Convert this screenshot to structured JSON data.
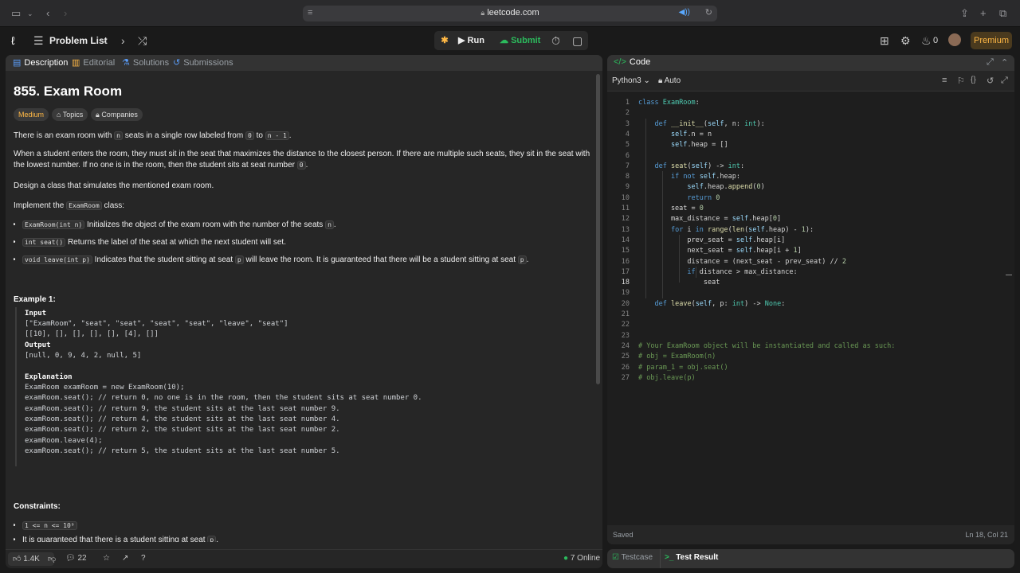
{
  "browser": {
    "url": "leetcode.com"
  },
  "nav": {
    "problem_list_label": "Problem List",
    "run_label": "Run",
    "submit_label": "Submit",
    "coins": "0",
    "premium_label": "Premium"
  },
  "left_tabs": [
    {
      "label": "Description",
      "icon": "document-icon"
    },
    {
      "label": "Editorial",
      "icon": "book-icon"
    },
    {
      "label": "Solutions",
      "icon": "flask-icon"
    },
    {
      "label": "Submissions",
      "icon": "history-icon"
    }
  ],
  "problem": {
    "title": "855. Exam Room",
    "difficulty": "Medium",
    "topics_label": "Topics",
    "companies_label": "Companies",
    "p1_a": "There is an exam room with ",
    "p1_code1": "n",
    "p1_b": " seats in a single row labeled from ",
    "p1_code2": "0",
    "p1_c": " to ",
    "p1_code3": "n - 1",
    "p1_d": ".",
    "p2_line1": "When a student enters the room, they must sit in the seat that maximizes the distance to the closest person. If there are multiple such seats, they sit in the seat with",
    "p2_line2_a": "the lowest number. If no one is in the room, then the student sits at seat number ",
    "p2_code": "0",
    "p2_line2_b": ".",
    "p3": "Design a class that simulates the mentioned exam room.",
    "p4_a": "Implement the ",
    "p4_code": "ExamRoom",
    "p4_b": " class:",
    "b1_code": "ExamRoom(int n)",
    "b1_a": " Initializes the object of the exam room with the number of the seats ",
    "b1_code2": "n",
    "b1_b": ".",
    "b2_code": "int seat()",
    "b2_a": " Returns the label of the seat at which the next student will set.",
    "b3_code": "void leave(int p)",
    "b3_a": " Indicates that the student sitting at seat ",
    "b3_code2": "p",
    "b3_b": " will leave the room. It is guaranteed that there will be a student sitting at seat ",
    "b3_code3": "p",
    "b3_c": ".",
    "example_title": "Example 1:",
    "example_lines": [
      "Input",
      "[\"ExamRoom\", \"seat\", \"seat\", \"seat\", \"seat\", \"leave\", \"seat\"]",
      "[[10], [], [], [], [], [4], []]",
      "Output",
      "[null, 0, 9, 4, 2, null, 5]",
      "",
      "Explanation",
      "ExamRoom examRoom = new ExamRoom(10);",
      "examRoom.seat(); // return 0, no one is in the room, then the student sits at seat number 0.",
      "examRoom.seat(); // return 9, the student sits at the last seat number 9.",
      "examRoom.seat(); // return 4, the student sits at the last seat number 4.",
      "examRoom.seat(); // return 2, the student sits at the last seat number 2.",
      "examRoom.leave(4);",
      "examRoom.seat(); // return 5, the student sits at the last seat number 5."
    ],
    "constraints_title": "Constraints:",
    "c1_code": "1 <= n <= 10⁹",
    "c2_a": "It is guaranteed that there is a student sitting at seat ",
    "c2_code": "p",
    "c2_b": "."
  },
  "left_footer": {
    "likes": "1.4K",
    "comments": "22",
    "online": "7 Online"
  },
  "code_panel": {
    "title": "Code",
    "language": "Python3",
    "mode": "Auto",
    "status_saved": "Saved",
    "cursor_pos": "Ln 18, Col 21"
  },
  "code_lines": [
    "class ExamRoom:",
    "",
    "    def __init__(self, n: int):",
    "        self.n = n",
    "        self.heap = []",
    "",
    "    def seat(self) -> int:",
    "        if not self.heap:",
    "            self.heap.append(0)",
    "            return 0",
    "        seat = 0",
    "        max_distance = self.heap[0]",
    "        for i in range(len(self.heap) - 1):",
    "            prev_seat = self.heap[i]",
    "            next_seat = self.heap[i + 1]",
    "            distance = (next_seat - prev_seat) // 2",
    "            if distance > max_distance:",
    "                seat",
    "",
    "    def leave(self, p: int) -> None:",
    "",
    "",
    "",
    "# Your ExamRoom object will be instantiated and called as such:",
    "# obj = ExamRoom(n)",
    "# param_1 = obj.seat()",
    "# obj.leave(p)"
  ],
  "bottom_tabs": {
    "testcase": "Testcase",
    "test_result": "Test Result"
  }
}
